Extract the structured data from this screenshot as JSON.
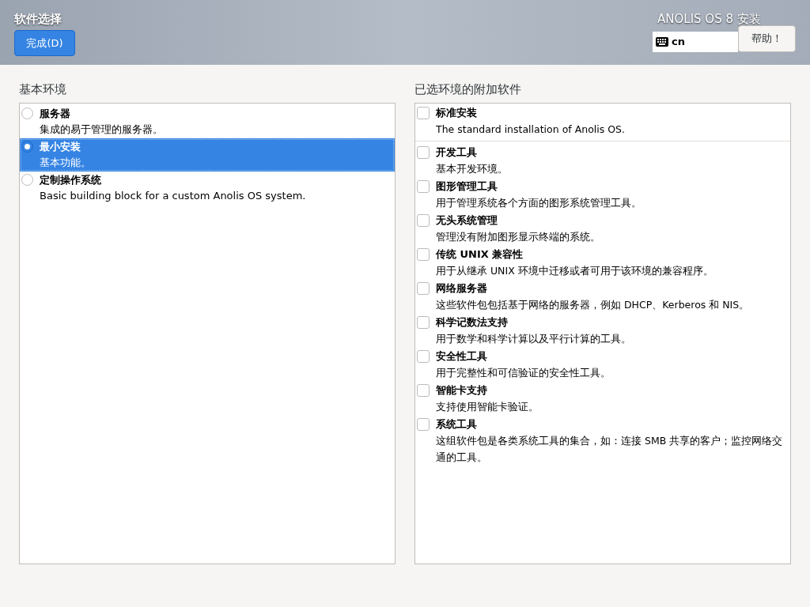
{
  "header": {
    "title": "软件选择",
    "done_button": "完成(D)",
    "product": "ANOLIS OS 8 安装",
    "keyboard": "cn",
    "help_button": "帮助！"
  },
  "base_environment": {
    "heading": "基本环境",
    "items": [
      {
        "name": "服务器",
        "description": "集成的易于管理的服务器。",
        "selected": false
      },
      {
        "name": "最小安装",
        "description": "基本功能。",
        "selected": true
      },
      {
        "name": "定制操作系统",
        "description": "Basic building block for a custom Anolis OS system.",
        "selected": false
      }
    ]
  },
  "addons": {
    "heading": "已选环境的附加软件",
    "items": [
      {
        "name": "标准安装",
        "description": "The standard installation of Anolis OS.",
        "checked": false,
        "divider_below": true
      },
      {
        "name": "开发工具",
        "description": "基本开发环境。",
        "checked": false,
        "divider_below": false
      },
      {
        "name": "图形管理工具",
        "description": "用于管理系统各个方面的图形系统管理工具。",
        "checked": false,
        "divider_below": false
      },
      {
        "name": "无头系统管理",
        "description": "管理没有附加图形显示终端的系统。",
        "checked": false,
        "divider_below": false
      },
      {
        "name": "传统 UNIX 兼容性",
        "description": "用于从继承 UNIX 环境中迁移或者可用于该环境的兼容程序。",
        "checked": false,
        "divider_below": false
      },
      {
        "name": "网络服务器",
        "description": "这些软件包包括基于网络的服务器，例如 DHCP、Kerberos 和 NIS。",
        "checked": false,
        "divider_below": false
      },
      {
        "name": "科学记数法支持",
        "description": "用于数学和科学计算以及平行计算的工具。",
        "checked": false,
        "divider_below": false
      },
      {
        "name": "安全性工具",
        "description": "用于完整性和可信验证的安全性工具。",
        "checked": false,
        "divider_below": false
      },
      {
        "name": "智能卡支持",
        "description": "支持使用智能卡验证。",
        "checked": false,
        "divider_below": false
      },
      {
        "name": "系统工具",
        "description": "这组软件包是各类系统工具的集合，如：连接 SMB 共享的客户；监控网络交通的工具。",
        "checked": false,
        "divider_below": false
      }
    ]
  }
}
